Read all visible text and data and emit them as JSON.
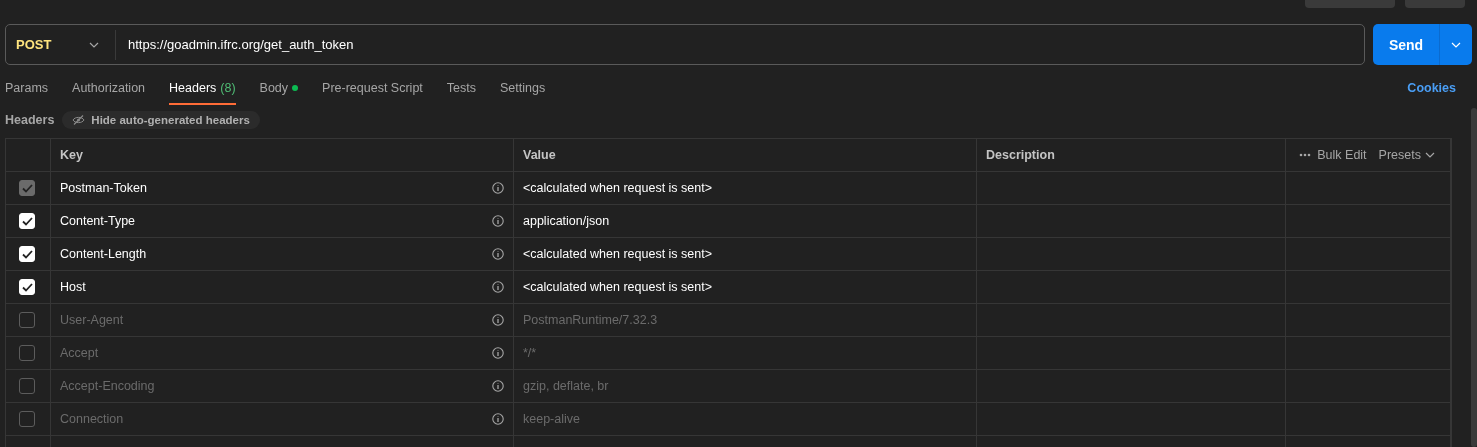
{
  "request": {
    "method": "POST",
    "url": "https://goadmin.ifrc.org/get_auth_token",
    "send": "Send"
  },
  "tabs": [
    {
      "label": "Params",
      "selected": false
    },
    {
      "label": "Authorization",
      "selected": false
    },
    {
      "label": "Headers",
      "count": "(8)",
      "selected": true
    },
    {
      "label": "Body",
      "dot": true,
      "selected": false
    },
    {
      "label": "Pre-request Script",
      "selected": false
    },
    {
      "label": "Tests",
      "selected": false
    },
    {
      "label": "Settings",
      "selected": false
    }
  ],
  "cookies": "Cookies",
  "headers_bar": {
    "title": "Headers",
    "toggle": "Hide auto-generated headers"
  },
  "table": {
    "columns": [
      "Key",
      "Value",
      "Description"
    ],
    "actions": {
      "bulk_edit": "Bulk Edit",
      "presets": "Presets"
    },
    "rows": [
      {
        "key": "Postman-Token",
        "value": "<calculated when request is sent>",
        "checked": true,
        "disabled": true
      },
      {
        "key": "Content-Type",
        "value": "application/json",
        "checked": true,
        "disabled": false
      },
      {
        "key": "Content-Length",
        "value": "<calculated when request is sent>",
        "checked": true,
        "disabled": false
      },
      {
        "key": "Host",
        "value": "<calculated when request is sent>",
        "checked": true,
        "disabled": false
      },
      {
        "key": "User-Agent",
        "value": "PostmanRuntime/7.32.3",
        "checked": false,
        "disabled": false
      },
      {
        "key": "Accept",
        "value": "*/*",
        "checked": false,
        "disabled": false
      },
      {
        "key": "Accept-Encoding",
        "value": "gzip, deflate, br",
        "checked": false,
        "disabled": false
      },
      {
        "key": "Connection",
        "value": "keep-alive",
        "checked": false,
        "disabled": false
      }
    ]
  }
}
